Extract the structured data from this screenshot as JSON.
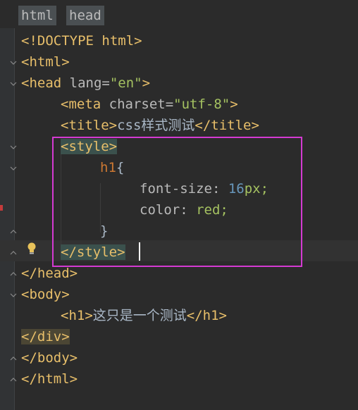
{
  "breadcrumbs": [
    "html",
    "head"
  ],
  "code": {
    "l1": "<!DOCTYPE html>",
    "l2": "<html>",
    "l3_open": "<head",
    "l3_attr": " lang=",
    "l3_val": "\"en\"",
    "l3_close": ">",
    "l4_open": "<meta",
    "l4_attr": " charset=",
    "l4_val": "\"utf-8\"",
    "l4_close": ">",
    "l5_open": "<title>",
    "l5_text": "css样式测试",
    "l5_close": "</title>",
    "l6": "<style>",
    "l7_sel": "h1",
    "l7_brace": "{",
    "l8_prop": "font-size: ",
    "l8_num": "16",
    "l8_unit": "px;",
    "l9_prop": "color: ",
    "l9_val": "red;",
    "l10": "}",
    "l11": "</style>",
    "l12": "</head>",
    "l13": "<body>",
    "l14_open": "<h1>",
    "l14_text": "这只是一个测试",
    "l14_close": "</h1>",
    "l15": "</div>",
    "l16": "</body>",
    "l17": "</html>"
  },
  "colors": {
    "annotation_box": "#d43ad2",
    "tag": "#e8bf6a",
    "string": "#a5c261"
  }
}
